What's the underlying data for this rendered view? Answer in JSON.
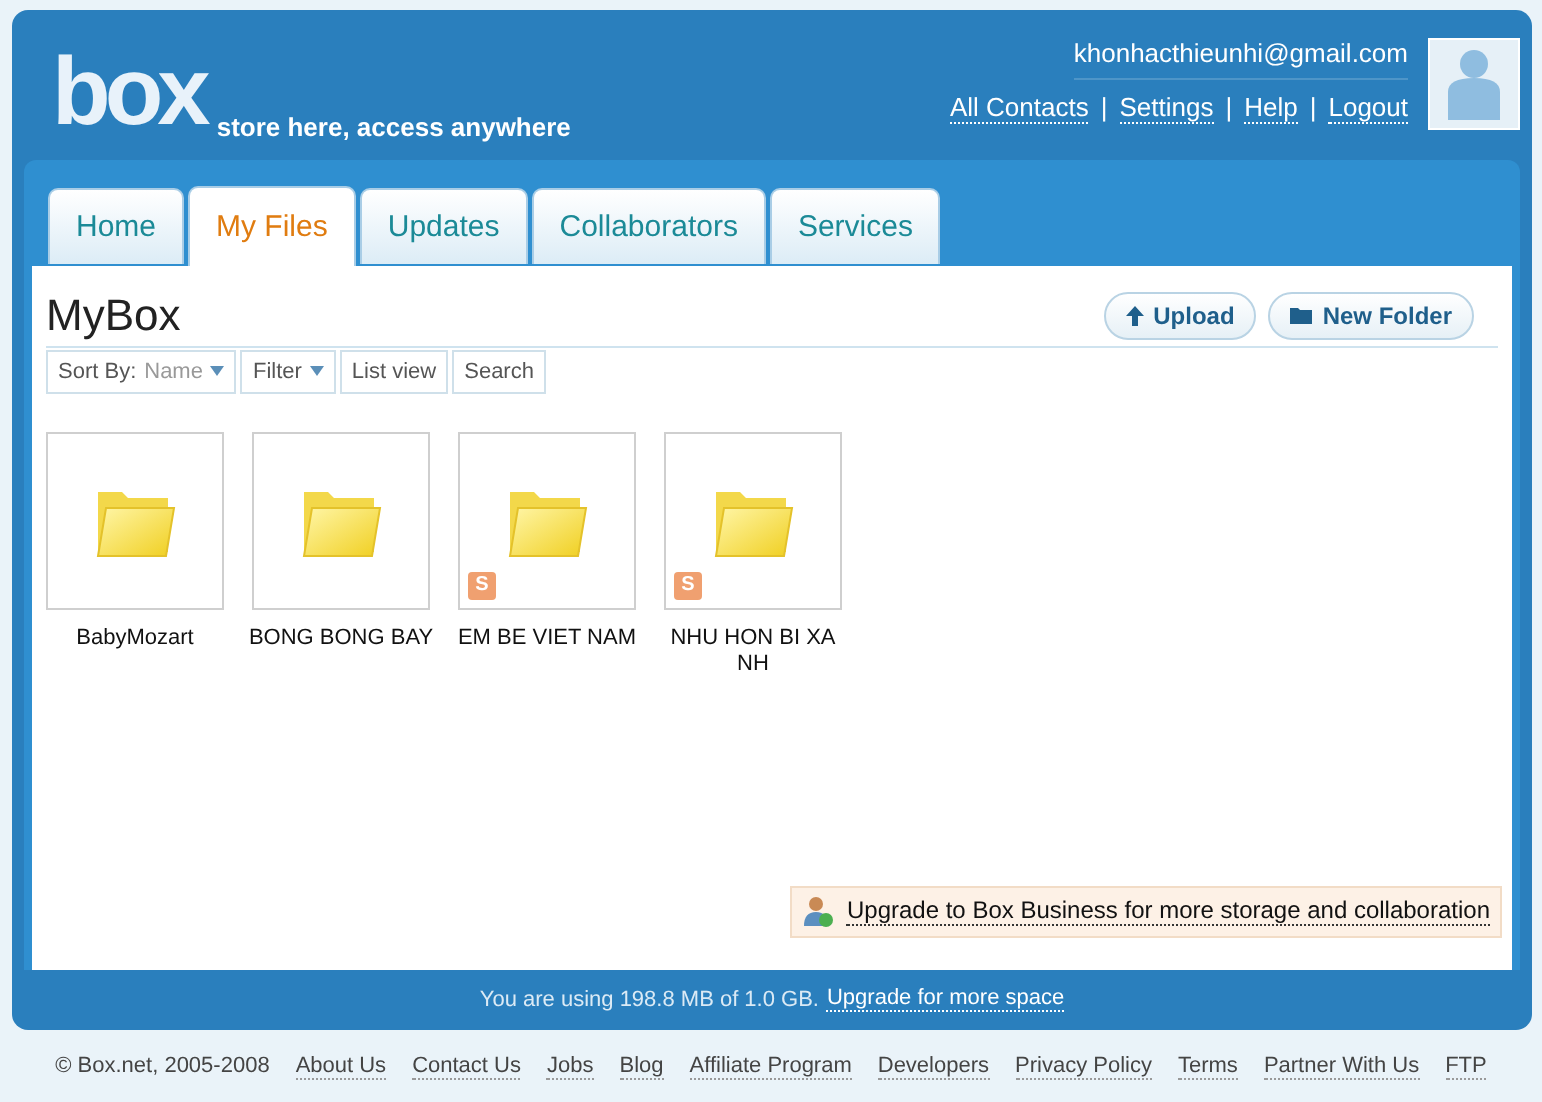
{
  "header": {
    "logo": "box",
    "tagline": "store here, access anywhere",
    "email": "khonhacthieunhi@gmail.com",
    "links": [
      "All Contacts",
      "Settings",
      "Help",
      "Logout"
    ],
    "separator": "|"
  },
  "tabs": [
    {
      "label": "Home",
      "selected": false
    },
    {
      "label": "My Files",
      "selected": true
    },
    {
      "label": "Updates",
      "selected": false
    },
    {
      "label": "Collaborators",
      "selected": false
    },
    {
      "label": "Services",
      "selected": false
    }
  ],
  "page_title": "MyBox",
  "actions": [
    "Upload",
    "New Folder"
  ],
  "toolbar": {
    "sort_label": "Sort By:",
    "sort_value": "Name",
    "filter": "Filter",
    "list_view": "List view",
    "search": "Search"
  },
  "folders": [
    {
      "name": "BabyMozart"
    },
    {
      "name": "BONG BONG BAY"
    },
    {
      "name": "EM BE VIET NAM",
      "badge": "S"
    },
    {
      "name": "NHU HON BI XA NH",
      "badge": "S"
    }
  ],
  "upgrade_banner": "Upgrade to Box Business for more storage and collaboration",
  "usage": {
    "text": "You are using 198.8 MB of 1.0 GB.",
    "link": "Upgrade for more space"
  },
  "footer": {
    "copyright": "© Box.net, 2005-2008",
    "links": [
      "About Us",
      "Contact Us",
      "Jobs",
      "Blog",
      "Affiliate Program",
      "Developers",
      "Privacy Policy",
      "Terms",
      "Partner With Us",
      "FTP"
    ]
  }
}
